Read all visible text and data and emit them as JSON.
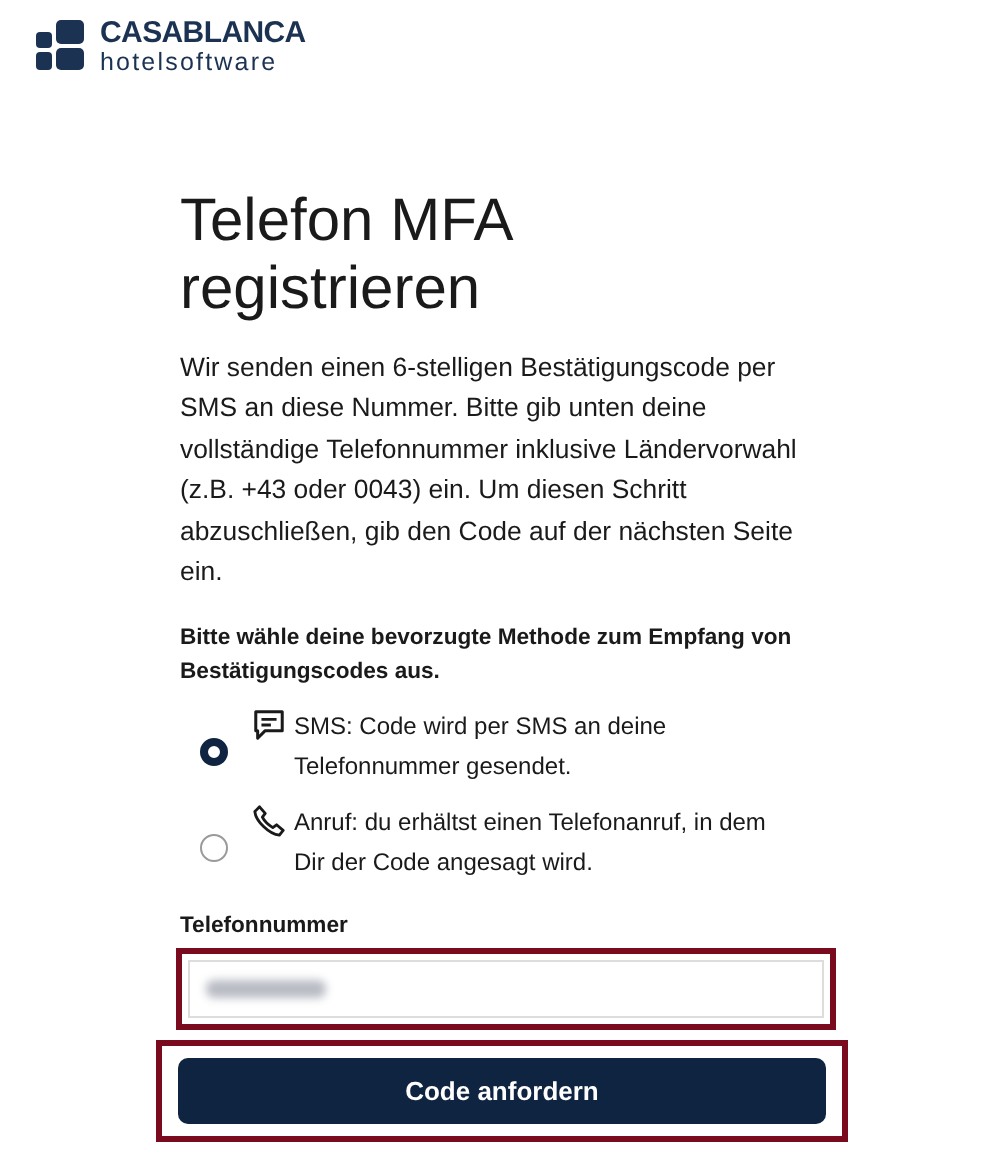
{
  "logo": {
    "brand": "CASABLANCA",
    "tagline": "hotelsoftware"
  },
  "title": "Telefon MFA registrieren",
  "description": "Wir senden einen 6-stelligen Bestätigungscode per SMS an diese Nummer. Bitte gib unten deine vollständige Telefonnummer inklusive Ländervorwahl (z.B. +43 oder 0043) ein. Um diesen Schritt abzuschließen, gib den Code auf der nächsten Seite ein.",
  "method_prompt": "Bitte wähle deine bevorzugte Methode zum Empfang von Bestätigungscodes aus.",
  "methods": [
    {
      "kind": "sms",
      "label": "SMS: Code wird per SMS an deine Telefonnummer gesendet.",
      "selected": true
    },
    {
      "kind": "call",
      "label": "Anruf: du erhältst einen Telefonanruf, in dem Dir der Code angesagt wird.",
      "selected": false
    }
  ],
  "phone_field": {
    "label": "Telefonnummer",
    "value_redacted": true,
    "highlighted": true
  },
  "submit_button": {
    "label": "Code anfordern",
    "highlighted": true
  }
}
